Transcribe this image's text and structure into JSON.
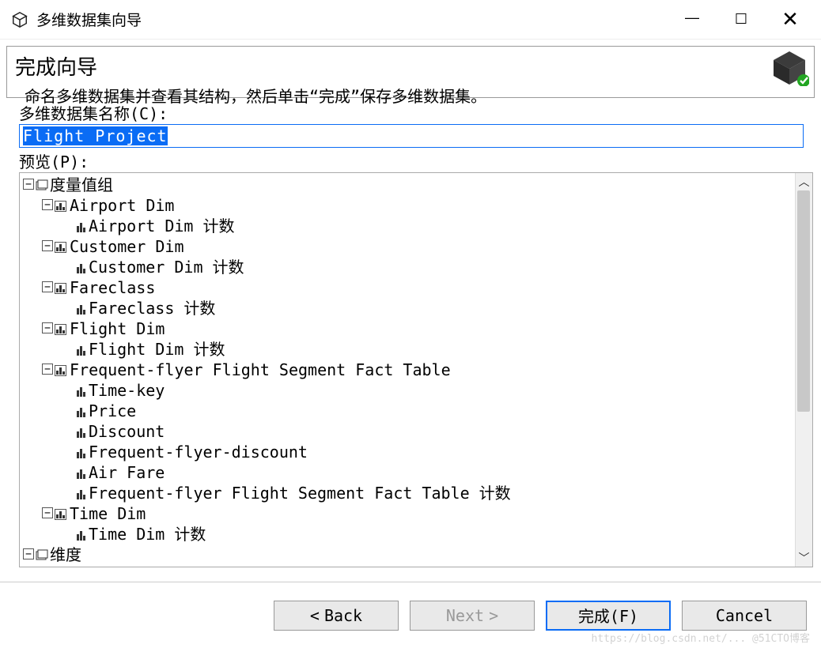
{
  "window": {
    "title": "多维数据集向导",
    "minimize_tooltip": "Minimize",
    "maximize_tooltip": "Maximize",
    "close_tooltip": "Close"
  },
  "header": {
    "title": "完成向导",
    "subtitle": "命名多维数据集并查看其结构，然后单击“完成”保存多维数据集。"
  },
  "fields": {
    "cube_name_label": "多维数据集名称(C):",
    "cube_name_value": "Flight Project",
    "preview_label": "预览(P):"
  },
  "tree": {
    "root": "度量值组",
    "groups": [
      {
        "name": "Airport Dim",
        "children": [
          "Airport Dim 计数"
        ]
      },
      {
        "name": "Customer Dim",
        "children": [
          "Customer Dim 计数"
        ]
      },
      {
        "name": "Fareclass",
        "children": [
          "Fareclass 计数"
        ]
      },
      {
        "name": "Flight Dim",
        "children": [
          "Flight Dim 计数"
        ]
      },
      {
        "name": "Frequent-flyer Flight Segment Fact Table",
        "children": [
          "Time-key",
          "Price",
          "Discount",
          "Frequent-flyer-discount",
          "Air Fare",
          "Frequent-flyer Flight Segment Fact Table 计数"
        ]
      },
      {
        "name": "Time Dim",
        "children": [
          "Time Dim 计数"
        ]
      }
    ],
    "dimensions_label": "维度"
  },
  "buttons": {
    "back": "Back",
    "next": "Next",
    "finish": "完成(F)",
    "cancel": "Cancel"
  },
  "watermark": "https://blog.csdn.net/... @51CTO博客"
}
